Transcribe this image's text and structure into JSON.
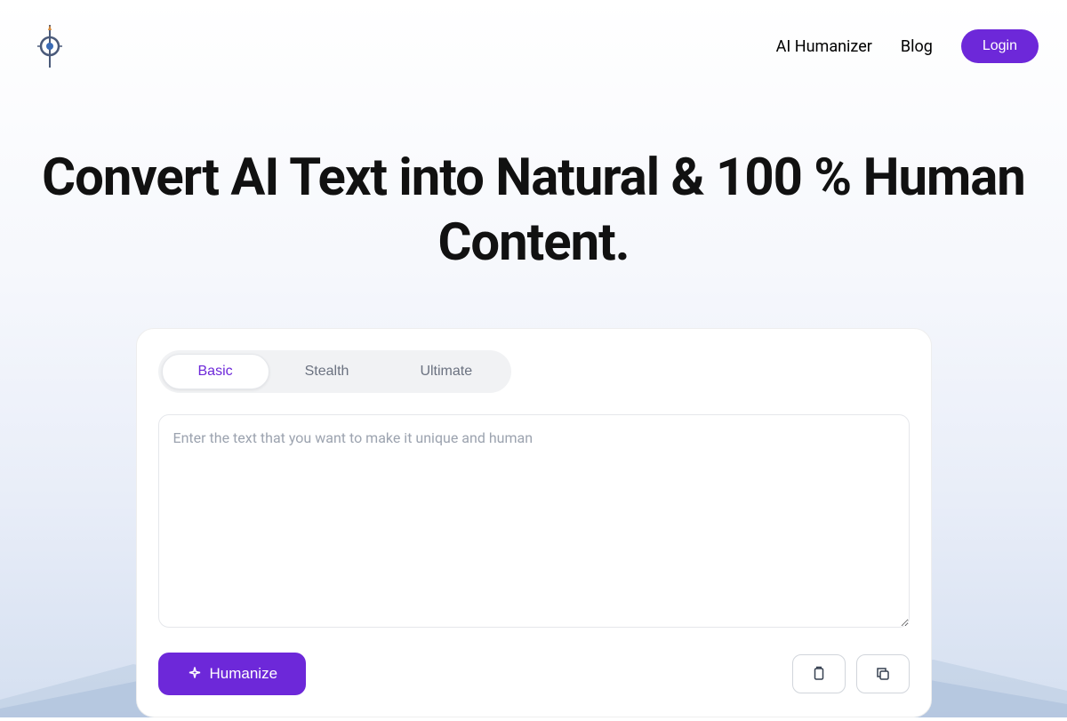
{
  "nav": {
    "link_humanizer": "AI Humanizer",
    "link_blog": "Blog",
    "login_label": "Login"
  },
  "hero": {
    "title": "Convert AI Text into Natural & 100 % Human Content."
  },
  "tool": {
    "tabs": {
      "basic": "Basic",
      "stealth": "Stealth",
      "ultimate": "Ultimate"
    },
    "input_placeholder": "Enter the text that you want to make it unique and human",
    "humanize_label": "Humanize"
  },
  "colors": {
    "primary": "#6d28d9",
    "text_muted": "#6b7280"
  }
}
